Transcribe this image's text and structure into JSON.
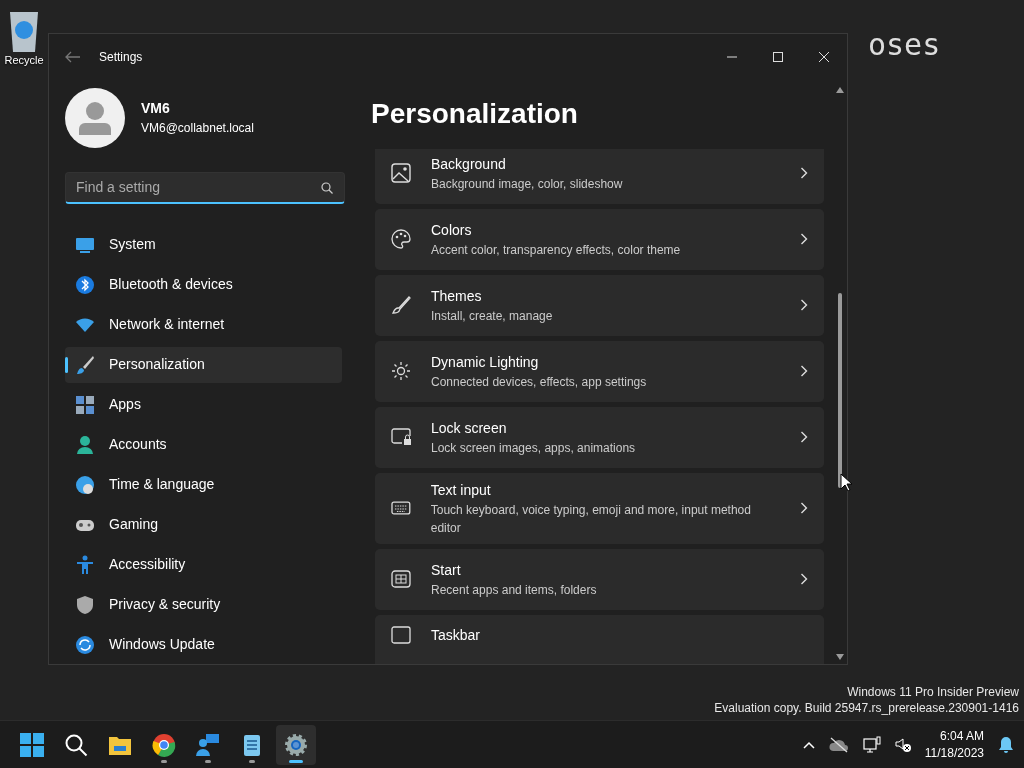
{
  "desktop": {
    "icon_label": "Recycle",
    "text_fragments": [
      "oses"
    ]
  },
  "window": {
    "title": "Settings"
  },
  "profile": {
    "name": "VM6",
    "email": "VM6@collabnet.local"
  },
  "search": {
    "placeholder": "Find a setting"
  },
  "nav": [
    {
      "label": "System",
      "selected": false
    },
    {
      "label": "Bluetooth & devices",
      "selected": false
    },
    {
      "label": "Network & internet",
      "selected": false
    },
    {
      "label": "Personalization",
      "selected": true
    },
    {
      "label": "Apps",
      "selected": false
    },
    {
      "label": "Accounts",
      "selected": false
    },
    {
      "label": "Time & language",
      "selected": false
    },
    {
      "label": "Gaming",
      "selected": false
    },
    {
      "label": "Accessibility",
      "selected": false
    },
    {
      "label": "Privacy & security",
      "selected": false
    },
    {
      "label": "Windows Update",
      "selected": false
    }
  ],
  "page_title": "Personalization",
  "settings": [
    {
      "title": "Background",
      "subtitle": "Background image, color, slideshow"
    },
    {
      "title": "Colors",
      "subtitle": "Accent color, transparency effects, color theme"
    },
    {
      "title": "Themes",
      "subtitle": "Install, create, manage"
    },
    {
      "title": "Dynamic Lighting",
      "subtitle": "Connected devices, effects, app settings"
    },
    {
      "title": "Lock screen",
      "subtitle": "Lock screen images, apps, animations"
    },
    {
      "title": "Text input",
      "subtitle": "Touch keyboard, voice typing, emoji and more, input method editor"
    },
    {
      "title": "Start",
      "subtitle": "Recent apps and items, folders"
    },
    {
      "title": "Taskbar"
    }
  ],
  "os_notice": [
    "Windows 11 Pro Insider Preview",
    "Evaluation copy. Build 25947.rs_prerelease.230901-1416"
  ],
  "taskbar": {
    "apps": [
      {
        "running": false,
        "selected": false
      },
      {
        "running": false,
        "selected": false
      },
      {
        "running": false,
        "selected": false
      },
      {
        "running": true,
        "selected": false
      },
      {
        "running": true,
        "selected": false
      },
      {
        "running": true,
        "selected": false
      },
      {
        "running": true,
        "selected": true
      }
    ],
    "time": "6:04 AM",
    "date": "11/18/2023"
  }
}
